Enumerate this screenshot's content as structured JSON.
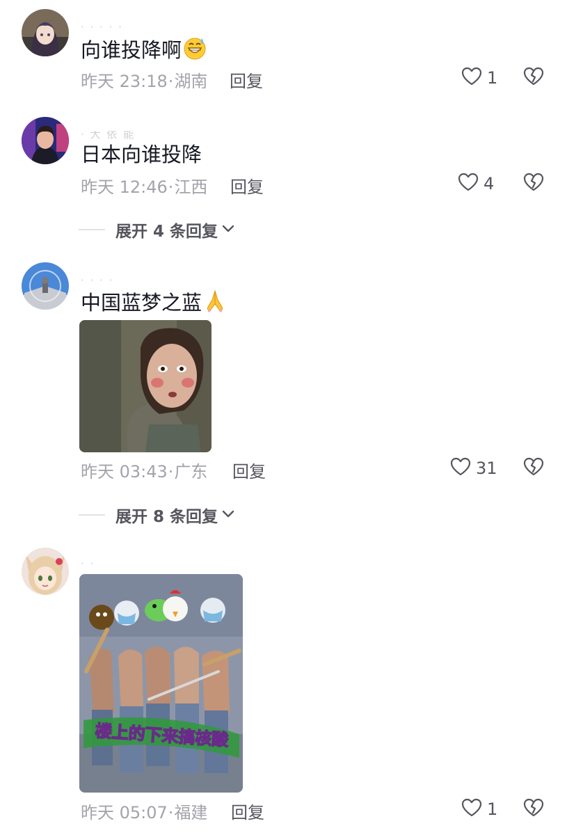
{
  "comments": [
    {
      "username": "· · · · ·",
      "text": "向谁投降啊",
      "emoji": "sweat-grin-emoji",
      "time": "昨天 23:18",
      "location": "湖南",
      "reply_label": "回复",
      "likes": "1"
    },
    {
      "username": "· 大 依 能",
      "text": "日本向谁投降",
      "time": "昨天 12:46",
      "location": "江西",
      "reply_label": "回复",
      "likes": "4",
      "expand_label": "展开 4 条回复"
    },
    {
      "username": "· · · ·",
      "text": "中国蓝梦之蓝",
      "emoji": "praying-hands-emoji",
      "time": "昨天 03:43",
      "location": "广东",
      "reply_label": "回复",
      "likes": "31",
      "expand_label": "展开 8 条回复"
    },
    {
      "username": "· ·",
      "meme_caption": "楼上的下来搞核酸",
      "time": "昨天 05:07",
      "location": "福建",
      "reply_label": "回复",
      "likes": "1"
    }
  ],
  "separator": "·",
  "colors": {
    "text": "#161823",
    "meta": "#a3a3ab",
    "action": "#55555e"
  }
}
